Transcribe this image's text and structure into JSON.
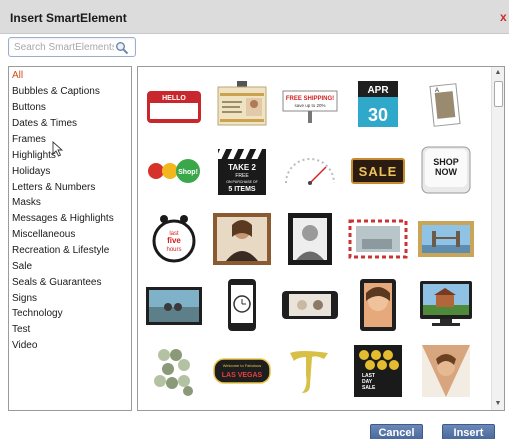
{
  "dialog": {
    "title": "Insert SmartElement",
    "close_glyph": "x"
  },
  "search": {
    "placeholder": "Search SmartElements",
    "value": "",
    "icon": "magnifier-icon"
  },
  "categories": [
    "All",
    "Bubbles & Captions",
    "Buttons",
    "Dates & Times",
    "Frames",
    "Highlights",
    "Holidays",
    "Letters & Numbers",
    "Masks",
    "Messages & Highlights",
    "Miscellaneous",
    "Recreation & Lifestyle",
    "Sale",
    "Seals & Guarantees",
    "Signs",
    "Technology",
    "Test",
    "Video"
  ],
  "selected_category": "All",
  "thumbnails": {
    "hello_badge": "HELLO",
    "free_shipping_line1": "FREE SHIPPING!",
    "free_shipping_line2": "save up to 20%",
    "calendar_month": "APR",
    "calendar_day": "30",
    "shop_bubbles": [
      "Shop!"
    ],
    "clapper": [
      "TAKE 2",
      "FREE",
      "ON PURCHASE OF",
      "5 ITEMS"
    ],
    "sale_sign": "SALE",
    "key_line1": "SHOP",
    "key_line2": "NOW",
    "clock_text": [
      "last",
      "five",
      "hours"
    ],
    "vegas_line1": "Welcome to Fabulous",
    "vegas_line2": "LAS VEGAS",
    "last_day_sale": [
      "LAST",
      "DAY",
      "SALE"
    ]
  },
  "buttons": {
    "cancel": "Cancel",
    "insert": "Insert"
  },
  "colors": {
    "accent": "#4b6a9c",
    "selected_category": "#d14b1a",
    "close": "#cc2a2a"
  }
}
